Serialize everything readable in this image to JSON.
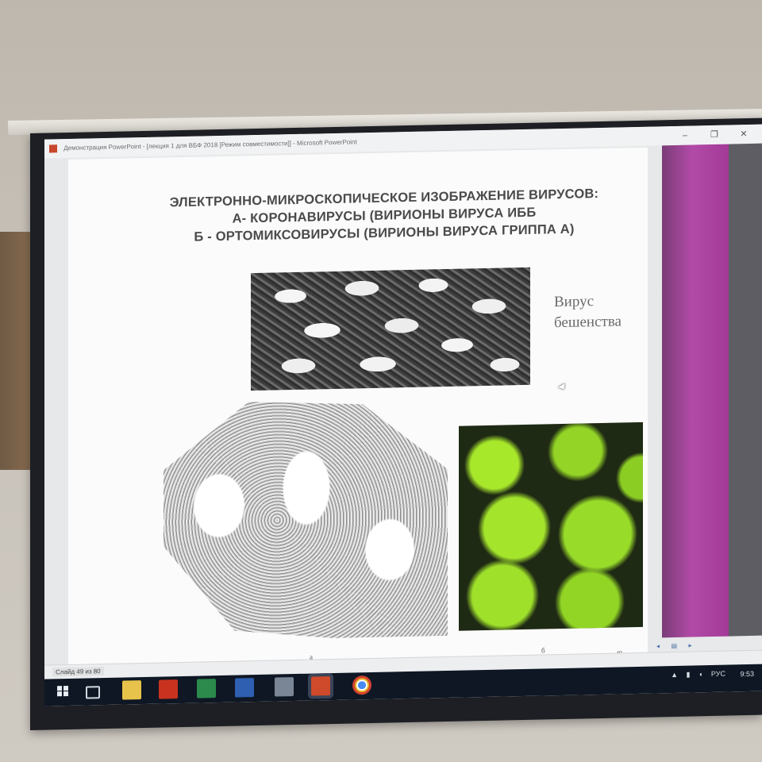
{
  "window": {
    "title": "Демонстрация PowerPoint - [лекция 1 для ВБФ 2018 [Режим совместимости]] - Microsoft PowerPoint",
    "controls": [
      "–",
      "❐",
      "✕"
    ]
  },
  "slide": {
    "title_lines": [
      "ЭЛЕКТРОННО-МИКРОСКОПИЧЕСКОЕ ИЗОБРАЖЕНИЕ ВИРУСОВ:",
      "А- КОРОНАВИРУСЫ (ВИРИОНЫ ВИРУСА ИББ",
      "Б - ОРТОМИКСОВИРУСЫ (ВИРИОНЫ ВИРУСА ГРИППА А)"
    ],
    "side_label_lines": [
      "Вирус",
      "бешенства"
    ],
    "caption_a": "а",
    "caption_b": "б",
    "slide_number": "49"
  },
  "status": {
    "slide_counter": "Слайд 49 из 80"
  },
  "presenter_controls": [
    "◂",
    "▤",
    "▸"
  ],
  "taskbar": {
    "apps": [
      "start-icon",
      "task-view-icon",
      "file-explorer-icon",
      "acrobat-icon",
      "excel-icon",
      "word-icon",
      "file-manager-icon",
      "powerpoint-icon",
      "chrome-icon"
    ],
    "tray_arrow": "▲",
    "tray_icons": [
      "network-icon",
      "volume-icon"
    ],
    "language": "РУС",
    "time": "9:53"
  },
  "colors": {
    "slide_accent": "#b24aa8",
    "taskbar": "#0f1724"
  }
}
